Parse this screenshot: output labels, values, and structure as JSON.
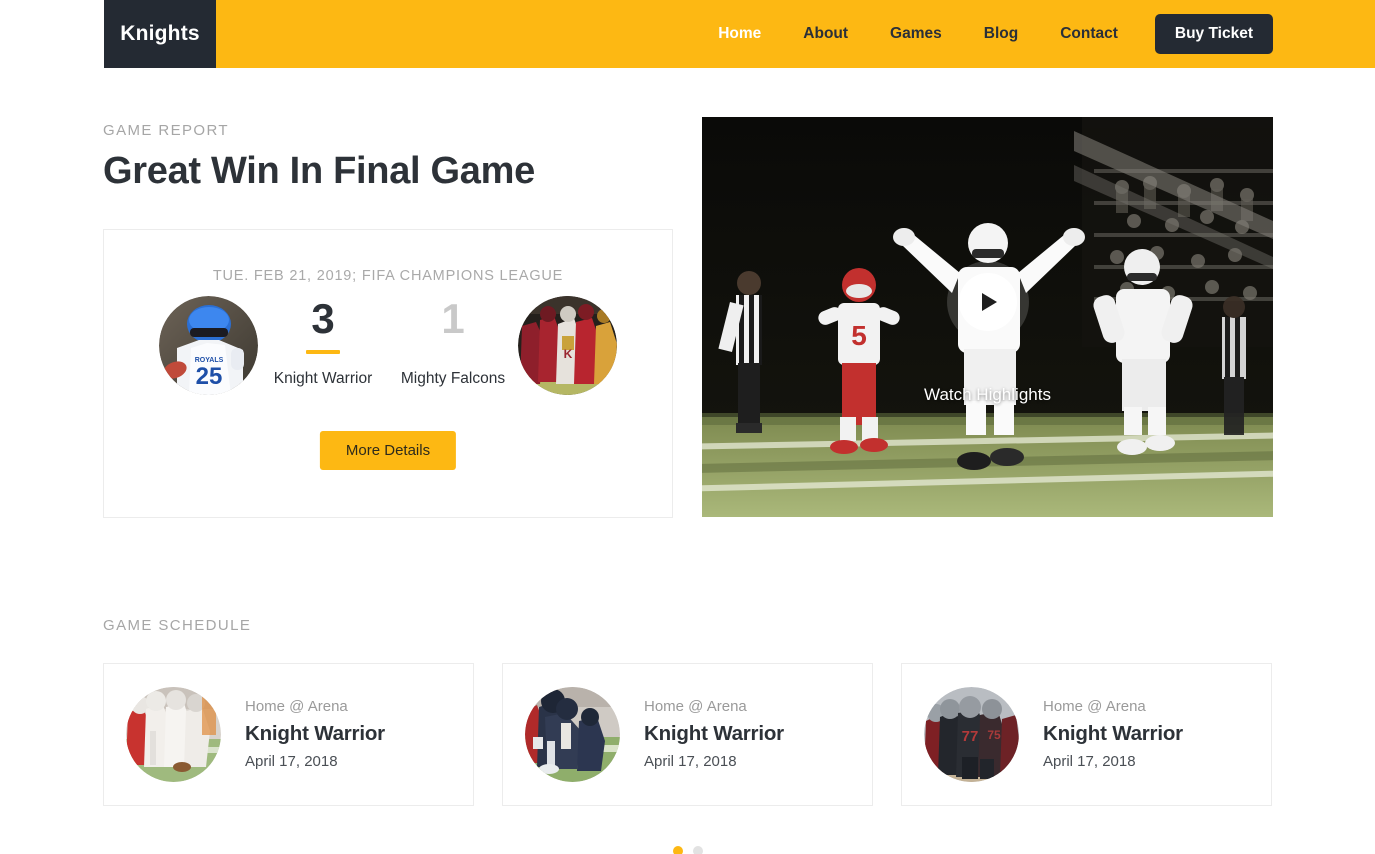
{
  "brand": {
    "name": "Knights"
  },
  "nav": {
    "items": [
      {
        "label": "Home",
        "active": true
      },
      {
        "label": "About",
        "active": false
      },
      {
        "label": "Games",
        "active": false
      },
      {
        "label": "Blog",
        "active": false
      },
      {
        "label": "Contact",
        "active": false
      }
    ],
    "cta_label": "Buy Ticket"
  },
  "report": {
    "eyebrow": "GAME REPORT",
    "headline": "Great Win In Final Game",
    "match": {
      "meta": "TUE. FEB 21, 2019; FIFA CHAMPIONS LEAGUE",
      "home": {
        "name": "Knight Warrior",
        "score": "3",
        "avatar": "player-blue-helmet-royals-25"
      },
      "away": {
        "name": "Mighty Falcons",
        "score": "1",
        "avatar": "team-red-gold-falcons"
      },
      "button_label": "More Details"
    }
  },
  "video": {
    "caption": "Watch Highlights",
    "play_icon": "play-icon",
    "thumbnail": "football-touchdown-celebration-night-game"
  },
  "schedule": {
    "eyebrow": "GAME SCHEDULE",
    "cards": [
      {
        "venue": "Home @ Arena",
        "team": "Knight Warrior",
        "date": "April 17, 2018",
        "avatar": "lineman-red-white-snap"
      },
      {
        "venue": "Home @ Arena",
        "team": "Knight Warrior",
        "date": "April 17, 2018",
        "avatar": "lineman-navy-stance"
      },
      {
        "venue": "Home @ Arena",
        "team": "Knight Warrior",
        "date": "April 17, 2018",
        "avatar": "team-huddle-77"
      }
    ],
    "pagination": {
      "total": 2,
      "active_index": 0
    }
  },
  "colors": {
    "accent": "#FDB813",
    "dark": "#242a33",
    "text": "#2d3238",
    "muted": "#a6a6a6",
    "border": "#ececec"
  }
}
